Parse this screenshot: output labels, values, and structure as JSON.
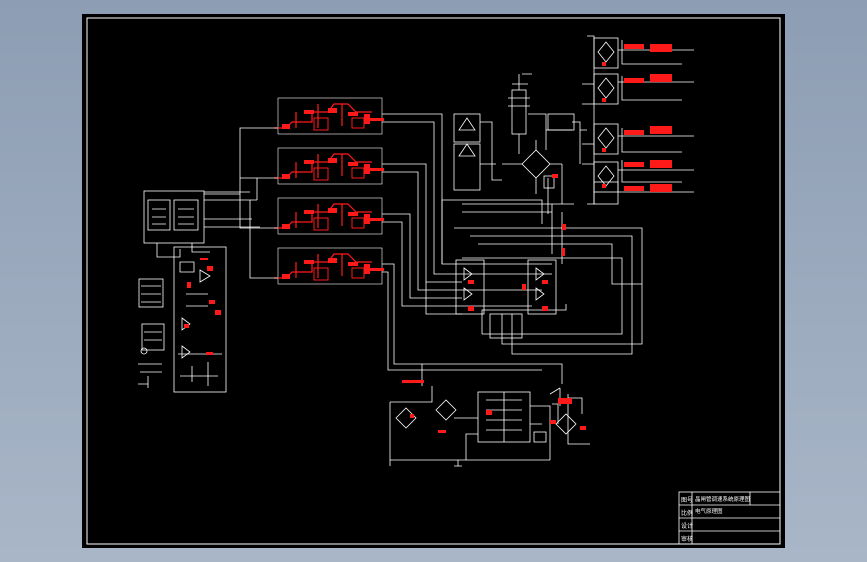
{
  "app": {
    "view": "cad-drawing-viewport"
  },
  "title_block": {
    "row_labels": [
      "图号",
      "比例",
      "设计",
      "审核"
    ],
    "title_line_1": "晶闸管调速系统原理图",
    "title_line_2": "电气原理图"
  },
  "colors": {
    "viewport_background": "#9aa8bd",
    "paper": "#000000",
    "line": "#ffffff",
    "component": "#ff1a1a"
  }
}
